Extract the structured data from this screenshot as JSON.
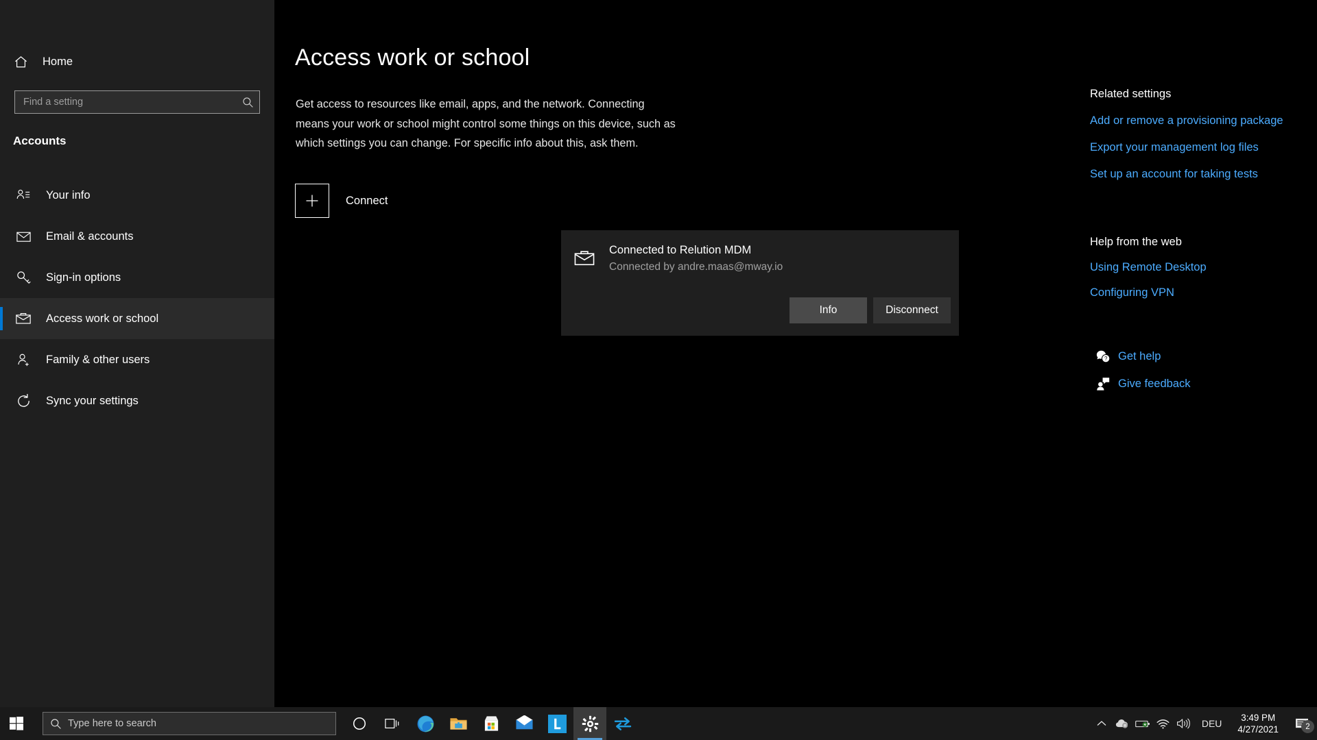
{
  "window": {
    "title": "Settings",
    "controls": {
      "minimize": "minimize-icon",
      "restore": "restore-icon",
      "close": "close-icon"
    }
  },
  "sidebar": {
    "home_label": "Home",
    "home_icon": "home-icon",
    "search": {
      "placeholder": "Find a setting",
      "value": "",
      "icon": "search-icon"
    },
    "section_title": "Accounts",
    "items": [
      {
        "label": "Your info",
        "icon": "your-info-icon",
        "active": false
      },
      {
        "label": "Email & accounts",
        "icon": "mail-icon",
        "active": false
      },
      {
        "label": "Sign-in options",
        "icon": "key-icon",
        "active": false
      },
      {
        "label": "Access work or school",
        "icon": "briefcase-icon",
        "active": true
      },
      {
        "label": "Family & other users",
        "icon": "person-add-icon",
        "active": false
      },
      {
        "label": "Sync your settings",
        "icon": "sync-icon",
        "active": false
      }
    ]
  },
  "main": {
    "page_title": "Access work or school",
    "description": "Get access to resources like email, apps, and the network. Connecting means your work or school might control some things on this device, such as which settings you can change. For specific info about this, ask them.",
    "connect": {
      "label": "Connect",
      "icon": "plus-icon"
    },
    "connection_card": {
      "icon": "briefcase-icon",
      "title": "Connected to Relution MDM",
      "subtitle": "Connected by andre.maas@mway.io",
      "buttons": [
        {
          "label": "Info",
          "state": "hover"
        },
        {
          "label": "Disconnect",
          "state": "normal"
        }
      ]
    }
  },
  "rail": {
    "related_settings": {
      "heading": "Related settings",
      "links": [
        "Add or remove a provisioning package",
        "Export your management log files",
        "Set up an account for taking tests"
      ]
    },
    "help_from_web": {
      "heading": "Help from the web",
      "links": [
        "Using Remote Desktop",
        "Configuring VPN"
      ]
    },
    "support": [
      {
        "label": "Get help",
        "icon": "question-bubble-icon"
      },
      {
        "label": "Give feedback",
        "icon": "feedback-person-icon"
      }
    ]
  },
  "taskbar": {
    "start_icon": "windows-start-icon",
    "search": {
      "placeholder": "Type here to search",
      "icon": "search-icon"
    },
    "icons": [
      {
        "name": "cortana-icon",
        "active": false
      },
      {
        "name": "task-view-icon",
        "active": false
      },
      {
        "name": "microsoft-edge-icon",
        "active": false
      },
      {
        "name": "file-explorer-icon",
        "active": false
      },
      {
        "name": "microsoft-store-icon",
        "active": false
      },
      {
        "name": "mail-app-icon",
        "active": false
      },
      {
        "name": "relution-app-icon",
        "active": false,
        "letter": "L"
      },
      {
        "name": "settings-gear-icon",
        "active": true
      },
      {
        "name": "transfer-arrows-icon",
        "active": false
      }
    ],
    "tray": {
      "chevron": "chevron-up-icon",
      "icons": [
        "onedrive-paused-icon",
        "battery-icon",
        "wifi-icon",
        "volume-icon"
      ],
      "language": "DEU",
      "time": "3:49 PM",
      "date": "4/27/2021",
      "notification_icon": "notification-icon",
      "notification_count": "2"
    }
  },
  "colors": {
    "accent": "#0078d4",
    "link": "#4cacff",
    "window_bg": "#000000",
    "sidebar_bg": "#1f1f1f",
    "card_bg": "#1f1f1f"
  }
}
